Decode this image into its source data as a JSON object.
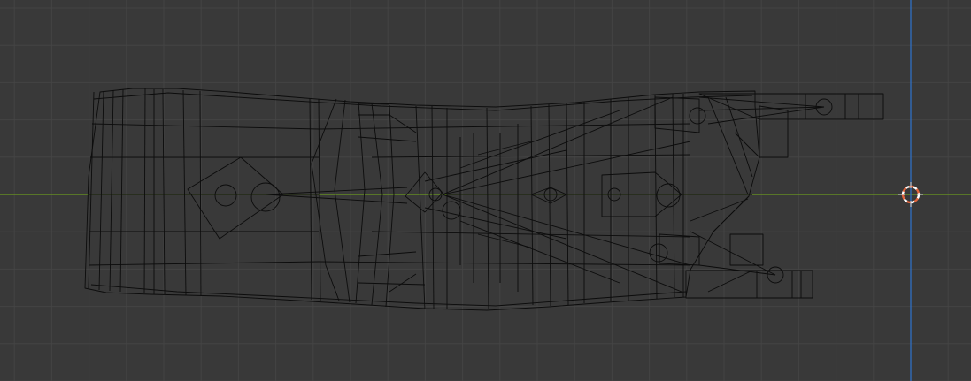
{
  "viewport": {
    "view": "3D Viewport",
    "shading": "wireframe",
    "background_color": "#393939",
    "grid_color": "#444444",
    "x_axis_color": "#6c9a1e",
    "y_axis_color": "#2f6fc4",
    "wire_color": "#0c0c0c",
    "cursor_colors": [
      "#ffffff",
      "#e3653c"
    ],
    "cursor_icon": "3d-cursor-icon",
    "object": "wireframe-mesh"
  }
}
